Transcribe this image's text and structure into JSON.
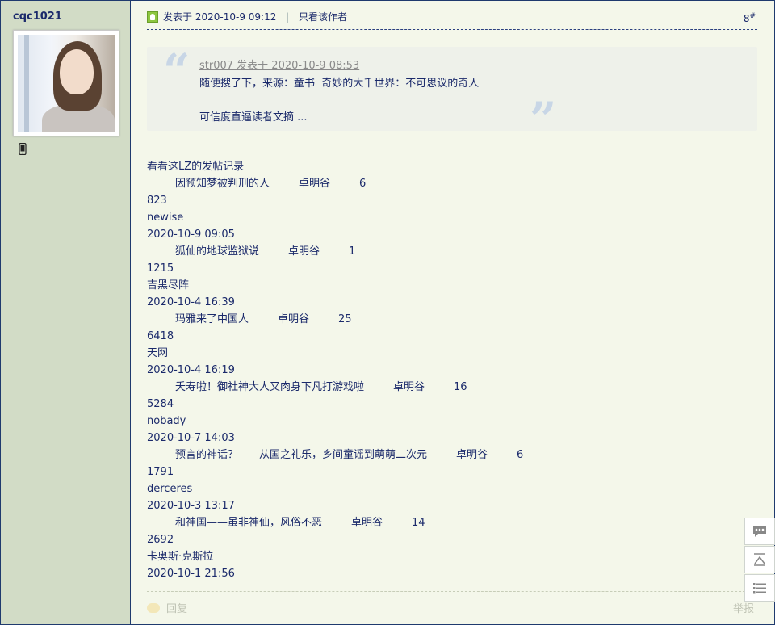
{
  "user": {
    "name": "cqc1021"
  },
  "post": {
    "posted_label": "发表于",
    "posted_time": "2020-10-9 09:12",
    "separator": "|",
    "only_author": "只看该作者",
    "floor_number": "8",
    "floor_mark": "#"
  },
  "quote": {
    "author": "str007 发表于 2020-10-9 08:53",
    "line1": "随便搜了下，来源：童书  奇妙的大千世界：不可思议的奇人",
    "line2": "可信度直逼读者文摘 ..."
  },
  "content": {
    "heading": "看看这LZ的发帖记录",
    "records": [
      {
        "title": "因预知梦被判刑的人",
        "author": "卓明谷",
        "replies": "6",
        "views": "823",
        "last_user": "newise",
        "last_time": "2020-10-9 09:05"
      },
      {
        "title": "狐仙的地球监狱说",
        "author": "卓明谷",
        "replies": "1",
        "views": "1215",
        "last_user": "吉黑尽阵",
        "last_time": "2020-10-4 16:39"
      },
      {
        "title": "玛雅来了中国人",
        "author": "卓明谷",
        "replies": "25",
        "views": "6418",
        "last_user": "天网",
        "last_time": "2020-10-4 16:19"
      },
      {
        "title": "夭寿啦！御社神大人又肉身下凡打游戏啦",
        "author": "卓明谷",
        "replies": "16",
        "views": "5284",
        "last_user": "nobady",
        "last_time": "2020-10-7 14:03"
      },
      {
        "title": "预言的神话？——从国之礼乐，乡间童谣到萌萌二次元",
        "author": "卓明谷",
        "replies": "6",
        "views": "1791",
        "last_user": "derceres",
        "last_time": "2020-10-3 13:17"
      },
      {
        "title": "和神国——虽非神仙，风俗不恶",
        "author": "卓明谷",
        "replies": "14",
        "views": "2692",
        "last_user": "卡奥斯·克斯拉",
        "last_time": "2020-10-1 21:56"
      }
    ]
  },
  "footer": {
    "reply": "回复",
    "report": "举报"
  },
  "icons": {
    "online": "online-status-icon",
    "phone": "mobile-phone-icon",
    "comment": "comment-icon",
    "top": "back-to-top-icon",
    "list": "list-icon"
  }
}
